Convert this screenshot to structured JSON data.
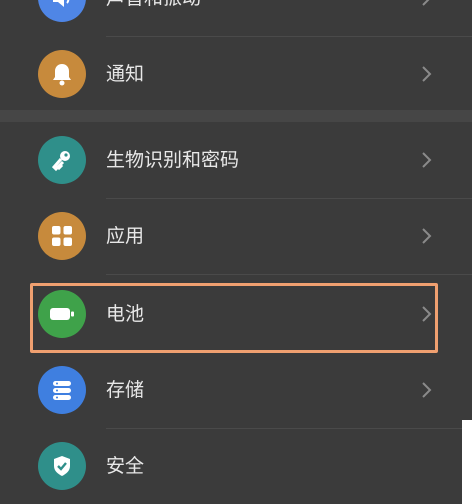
{
  "settings": {
    "items": [
      {
        "id": "sound",
        "label": "声音和振动",
        "icon": "speaker-icon",
        "color": "#4f86e6"
      },
      {
        "id": "notifications",
        "label": "通知",
        "icon": "bell-icon",
        "color": "#c78a3c"
      },
      {
        "id": "biometrics",
        "label": "生物识别和密码",
        "icon": "key-icon",
        "color": "#2f8f8a"
      },
      {
        "id": "apps",
        "label": "应用",
        "icon": "apps-grid-icon",
        "color": "#c78a3c"
      },
      {
        "id": "battery",
        "label": "电池",
        "icon": "battery-icon",
        "color": "#3fa24a"
      },
      {
        "id": "storage",
        "label": "存储",
        "icon": "storage-icon",
        "color": "#3f7fe0"
      },
      {
        "id": "security",
        "label": "安全",
        "icon": "shield-check-icon",
        "color": "#2f8f8a"
      }
    ]
  },
  "highlight": {
    "target": "battery",
    "color": "#f0a070"
  }
}
